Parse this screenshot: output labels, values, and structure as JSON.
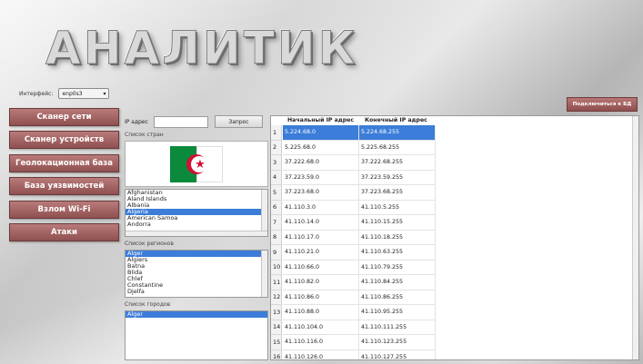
{
  "app": {
    "logo": "АНАЛИТИК"
  },
  "interface": {
    "label": "Интерфейс:",
    "value": "enp0s3"
  },
  "connect_button": "Подключиться к БД",
  "menu": [
    "Сканер сети",
    "Сканер устройств",
    "Геолокационная база",
    "База уязвимостей",
    "Взлом Wi-Fi",
    "Атаки"
  ],
  "ip_search": {
    "label": "IP адрес",
    "value": "",
    "button": "Запрос"
  },
  "countries": {
    "label": "Список стран",
    "items": [
      "Afghanistan",
      "Aland Islands",
      "Albania",
      "Algeria",
      "American Samoa",
      "Andorra"
    ],
    "selected": "Algeria"
  },
  "regions": {
    "label": "Список регионов",
    "items": [
      "Alger",
      "Algiers",
      "Batna",
      "Blida",
      "Chlef",
      "Constantine",
      "Djelfa"
    ],
    "selected": "Alger"
  },
  "cities": {
    "label": "Список городов",
    "items": [
      "Alger"
    ],
    "selected": "Alger"
  },
  "table": {
    "headers": [
      "Начальный IP адрес",
      "Конечный IP адрес"
    ],
    "rows": [
      [
        "1",
        "5.224.68.0",
        "5.224.68.255"
      ],
      [
        "2",
        "5.225.68.0",
        "5.225.68.255"
      ],
      [
        "3",
        "37.222.68.0",
        "37.222.68.255"
      ],
      [
        "4",
        "37.223.59.0",
        "37.223.59.255"
      ],
      [
        "5",
        "37.223.68.0",
        "37.223.68.255"
      ],
      [
        "6",
        "41.110.3.0",
        "41.110.5.255"
      ],
      [
        "7",
        "41.110.14.0",
        "41.110.15.255"
      ],
      [
        "8",
        "41.110.17.0",
        "41.110.18.255"
      ],
      [
        "9",
        "41.110.21.0",
        "41.110.63.255"
      ],
      [
        "10",
        "41.110.66.0",
        "41.110.79.255"
      ],
      [
        "11",
        "41.110.82.0",
        "41.110.84.255"
      ],
      [
        "12",
        "41.110.86.0",
        "41.110.86.255"
      ],
      [
        "13",
        "41.110.88.0",
        "41.110.95.255"
      ],
      [
        "14",
        "41.110.104.0",
        "41.110.111.255"
      ],
      [
        "15",
        "41.110.116.0",
        "41.110.123.255"
      ],
      [
        "16",
        "41.110.126.0",
        "41.110.127.255"
      ]
    ],
    "selected_row": 0
  },
  "colors": {
    "button": "#a46464",
    "selection": "#3b7dd8",
    "flag_green": "#0b8a3c",
    "flag_red": "#d21034"
  },
  "icons": {
    "flag": "algeria-flag",
    "dropdown": "chevron-down-icon"
  }
}
